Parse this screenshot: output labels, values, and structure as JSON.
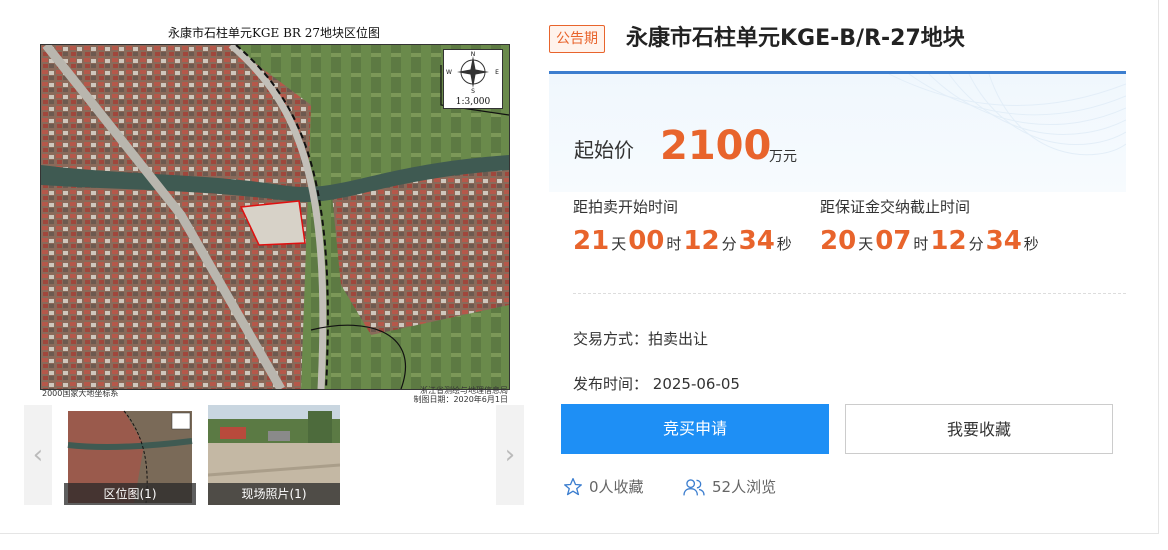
{
  "map": {
    "title": "永康市石柱单元KGE BR 27地块区位图",
    "scale": "1:3,000",
    "footer_left": "2000国家大地坐标系",
    "footer_right_1": "浙江省测绘与地理信息局",
    "footer_right_2": "制图日期：2020年6月1日"
  },
  "thumbnails": [
    {
      "caption": "区位图(1)"
    },
    {
      "caption": "现场照片(1)"
    }
  ],
  "listing": {
    "status_badge": "公告期",
    "title": "永康市石柱单元KGE-B/R-27地块",
    "price_label": "起始价",
    "price_value": "2100",
    "price_unit": "万元"
  },
  "countdowns": [
    {
      "label": "距拍卖开始时间",
      "days": "21",
      "hours": "00",
      "minutes": "12",
      "seconds": "34"
    },
    {
      "label": "距保证金交纳截止时间",
      "days": "20",
      "hours": "07",
      "minutes": "12",
      "seconds": "34"
    }
  ],
  "units": {
    "day": "天",
    "hour": "时",
    "minute": "分",
    "second": "秒"
  },
  "details": {
    "trade_method": "交易方式：拍卖出让",
    "publish_label": "发布时间：",
    "publish_date": "2025-06-05"
  },
  "actions": {
    "bid_label": "竞买申请",
    "favorite_label": "我要收藏"
  },
  "stats": {
    "favorites": "0人收藏",
    "views": "52人浏览"
  },
  "colors": {
    "accent": "#e8642c",
    "primary": "#1e8ff5",
    "rule": "#3c7ecf"
  }
}
